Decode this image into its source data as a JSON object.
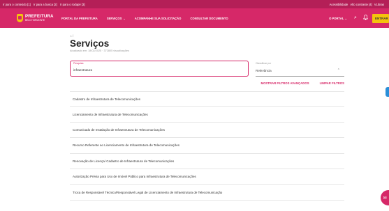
{
  "a11y_bar": {
    "skip_links": [
      "Ir para o conteúdo [1]",
      "Ir para a busca [2]",
      "Ir para o rodapé [3]"
    ],
    "accessibility": "Acessibilidade",
    "contrast": "Alto contraste [4]",
    "vlibras": "VLibras"
  },
  "header": {
    "logo_line1": "PREFEITURA",
    "logo_line2": "BELO HORIZONTE",
    "nav": [
      {
        "label": "PORTAL DA PREFEITURA"
      },
      {
        "label": "SERVIÇOS",
        "chevron": "⌄"
      },
      {
        "label": "ACOMPANHE SUA SOLICITAÇÃO"
      },
      {
        "label": "CONSULTAR DOCUMENTO"
      }
    ],
    "portal_label": "O PORTAL",
    "portal_chevron": "⌄",
    "search_icon": "⌕",
    "bell_icon": "🔔",
    "entrar_label": "ENTRAR"
  },
  "page": {
    "breadcrumb": "⌂ /",
    "title": "Serviços",
    "updated": "Atualizado em: 18/02/2025 · 372805 visualizações"
  },
  "filters": {
    "search_label": "Pesquisa",
    "search_value": "infraestrutura",
    "sort_label": "Classificar por",
    "sort_value": "Relevância",
    "sort_caret": "⌃",
    "advanced_label": "MOSTRAR FILTROS AVANÇADOS",
    "clear_label": "LIMPAR FILTROS"
  },
  "results": [
    "Cadastro de Infraestrutura de Telecomunicações",
    "Licenciamento de Infraestrutura de Telecomunicações",
    "Comunicado de Instalação de Infraestrutura de Telecomunicações",
    "Recurso Referente ao Licenciamento de Infraestrutura de Telecomunicações",
    "Renovação de Licença/ Cadastro de Infraestrutura de Telecomunicações",
    "Autorização Prévia para Uso de Imóvel Público para Infraestrutura de Telecomunicações",
    "Troca de Responsável Técnico/Responsável Legal de Licenciamento de Infraestrutura de Telecomunicação"
  ],
  "chat_icon": "✉",
  "colors": {
    "brand": "#d62868",
    "brand_dark": "#b41f57",
    "accent": "#f4c20d",
    "side_tab": "#2a8fd8"
  }
}
